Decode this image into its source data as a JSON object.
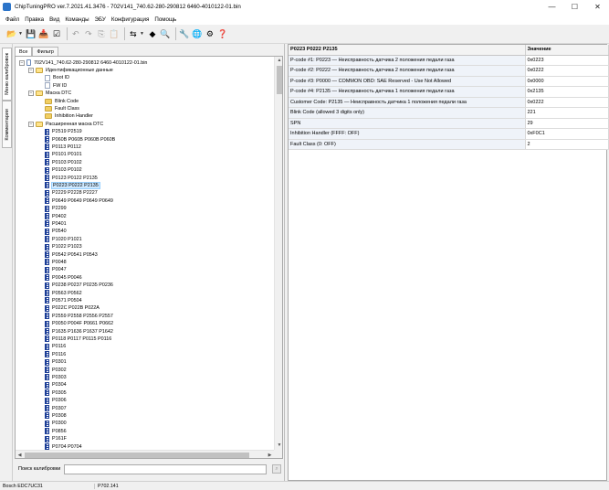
{
  "window": {
    "title": "ChipTuningPRO ver.7.2021.41.3476 - 702V141_740.62-280-290812 6460-4010122-01.bin",
    "controls": {
      "minimize": "—",
      "maximize": "☐",
      "close": "✕"
    }
  },
  "menu": [
    "Файл",
    "Правка",
    "Вид",
    "Команды",
    "ЭБУ",
    "Конфигурация",
    "Помощь"
  ],
  "toolbar": [
    {
      "name": "open-icon",
      "glyph": "📂",
      "dim": false,
      "dropdown": true
    },
    {
      "name": "save-icon",
      "glyph": "💾",
      "dim": false,
      "dropdown": false
    },
    {
      "name": "save-as-icon",
      "glyph": "📥",
      "dim": false,
      "dropdown": false
    },
    {
      "name": "checksum-icon",
      "glyph": "☑",
      "dim": false,
      "dropdown": false
    },
    {
      "name": "undo-icon",
      "glyph": "↶",
      "dim": true,
      "dropdown": false
    },
    {
      "name": "redo-icon",
      "glyph": "↷",
      "dim": true,
      "dropdown": false
    },
    {
      "name": "copy-icon",
      "glyph": "⎘",
      "dim": true,
      "dropdown": false
    },
    {
      "name": "paste-icon",
      "glyph": "📋",
      "dim": true,
      "dropdown": false
    },
    {
      "name": "compare-icon",
      "glyph": "⇆",
      "dim": false,
      "dropdown": true
    },
    {
      "name": "navigate-icon",
      "glyph": "◆",
      "dim": false,
      "dropdown": false
    },
    {
      "name": "search-icon",
      "glyph": "🔍",
      "dim": false,
      "dropdown": false
    },
    {
      "name": "tools-icon",
      "glyph": "🔧",
      "dim": false,
      "dropdown": false
    },
    {
      "name": "web-update-icon",
      "glyph": "🌐",
      "dim": false,
      "dropdown": false
    },
    {
      "name": "settings-icon",
      "glyph": "⚙",
      "dim": false,
      "dropdown": false
    },
    {
      "name": "help-icon",
      "glyph": "❓",
      "dim": false,
      "dropdown": false
    }
  ],
  "sidebar_tabs": [
    "Меню калибровок",
    "Комментарии"
  ],
  "left_tabs": [
    "Все",
    "Фильтр"
  ],
  "tree": [
    {
      "level": 0,
      "icon": "file",
      "toggle": "−",
      "label": "702V141_740.62-280-290812 6460-4010122-01.bin"
    },
    {
      "level": 1,
      "icon": "folder-open",
      "toggle": "−",
      "label": "Идентификационные данные"
    },
    {
      "level": 2,
      "icon": "page",
      "toggle": "",
      "label": "Boot ID"
    },
    {
      "level": 2,
      "icon": "page",
      "toggle": "",
      "label": "FW ID"
    },
    {
      "level": 1,
      "icon": "folder-open",
      "toggle": "−",
      "label": "Маска DTC"
    },
    {
      "level": 2,
      "icon": "folder",
      "toggle": "",
      "label": "Blink Code"
    },
    {
      "level": 2,
      "icon": "folder",
      "toggle": "",
      "label": "Fault Class"
    },
    {
      "level": 2,
      "icon": "folder",
      "toggle": "",
      "label": "Inhibition Handler"
    },
    {
      "level": 1,
      "icon": "folder-open",
      "toggle": "−",
      "label": "Расширенная маска DTC"
    },
    {
      "level": 2,
      "icon": "dtc",
      "toggle": "",
      "label": "P2519 P2519"
    },
    {
      "level": 2,
      "icon": "dtc",
      "toggle": "",
      "label": "P060B P060B P060B P060B"
    },
    {
      "level": 2,
      "icon": "dtc",
      "toggle": "",
      "label": "P0113 P0112"
    },
    {
      "level": 2,
      "icon": "dtc",
      "toggle": "",
      "label": "P0101 P0101"
    },
    {
      "level": 2,
      "icon": "dtc",
      "toggle": "",
      "label": "P0103 P0102"
    },
    {
      "level": 2,
      "icon": "dtc",
      "toggle": "",
      "label": "P0103 P0102"
    },
    {
      "level": 2,
      "icon": "dtc",
      "toggle": "",
      "label": "P0123 P0122 P2135"
    },
    {
      "level": 2,
      "icon": "dtc",
      "toggle": "",
      "label": "P0223 P0222 P2135",
      "selected": true
    },
    {
      "level": 2,
      "icon": "dtc",
      "toggle": "",
      "label": "P2229 P2228 P2227"
    },
    {
      "level": 2,
      "icon": "dtc",
      "toggle": "",
      "label": "P0649 P0649 P0649 P0649"
    },
    {
      "level": 2,
      "icon": "dtc",
      "toggle": "",
      "label": "P2299"
    },
    {
      "level": 2,
      "icon": "dtc",
      "toggle": "",
      "label": "P0402"
    },
    {
      "level": 2,
      "icon": "dtc",
      "toggle": "",
      "label": "P0401"
    },
    {
      "level": 2,
      "icon": "dtc",
      "toggle": "",
      "label": "P0540"
    },
    {
      "level": 2,
      "icon": "dtc",
      "toggle": "",
      "label": "P1020 P1021"
    },
    {
      "level": 2,
      "icon": "dtc",
      "toggle": "",
      "label": "P1022 P1023"
    },
    {
      "level": 2,
      "icon": "dtc",
      "toggle": "",
      "label": "P0542 P0541 P0543"
    },
    {
      "level": 2,
      "icon": "dtc",
      "toggle": "",
      "label": "P0048"
    },
    {
      "level": 2,
      "icon": "dtc",
      "toggle": "",
      "label": "P0047"
    },
    {
      "level": 2,
      "icon": "dtc",
      "toggle": "",
      "label": "P0045 P0046"
    },
    {
      "level": 2,
      "icon": "dtc",
      "toggle": "",
      "label": "P0238 P0237 P0235 P0236"
    },
    {
      "level": 2,
      "icon": "dtc",
      "toggle": "",
      "label": "P0563 P0562"
    },
    {
      "level": 2,
      "icon": "dtc",
      "toggle": "",
      "label": "P0571 P0504"
    },
    {
      "level": 2,
      "icon": "dtc",
      "toggle": "",
      "label": "P022C P022B P022A"
    },
    {
      "level": 2,
      "icon": "dtc",
      "toggle": "",
      "label": "P2559 P2558 P2556 P2557"
    },
    {
      "level": 2,
      "icon": "dtc",
      "toggle": "",
      "label": "P0050 P004F P0661 P0662"
    },
    {
      "level": 2,
      "icon": "dtc",
      "toggle": "",
      "label": "P1635 P1636 P1637 P1642"
    },
    {
      "level": 2,
      "icon": "dtc",
      "toggle": "",
      "label": "P0118 P0117 P0115 P0116"
    },
    {
      "level": 2,
      "icon": "dtc",
      "toggle": "",
      "label": "P0116"
    },
    {
      "level": 2,
      "icon": "dtc",
      "toggle": "",
      "label": "P0116"
    },
    {
      "level": 2,
      "icon": "dtc",
      "toggle": "",
      "label": "P0301"
    },
    {
      "level": 2,
      "icon": "dtc",
      "toggle": "",
      "label": "P0302"
    },
    {
      "level": 2,
      "icon": "dtc",
      "toggle": "",
      "label": "P0303"
    },
    {
      "level": 2,
      "icon": "dtc",
      "toggle": "",
      "label": "P0304"
    },
    {
      "level": 2,
      "icon": "dtc",
      "toggle": "",
      "label": "P0305"
    },
    {
      "level": 2,
      "icon": "dtc",
      "toggle": "",
      "label": "P0306"
    },
    {
      "level": 2,
      "icon": "dtc",
      "toggle": "",
      "label": "P0307"
    },
    {
      "level": 2,
      "icon": "dtc",
      "toggle": "",
      "label": "P0308"
    },
    {
      "level": 2,
      "icon": "dtc",
      "toggle": "",
      "label": "P0300"
    },
    {
      "level": 2,
      "icon": "dtc",
      "toggle": "",
      "label": "P0856"
    },
    {
      "level": 2,
      "icon": "dtc",
      "toggle": "",
      "label": "P161F"
    },
    {
      "level": 2,
      "icon": "dtc",
      "toggle": "",
      "label": "P0704 P0704"
    }
  ],
  "search": {
    "label": "Поиск калибровки",
    "value": "",
    "button": "⌕"
  },
  "table": {
    "headers": [
      "P0223 P0222 P2135",
      "Значение"
    ],
    "rows": [
      {
        "param": "P-code #1: P0223 — Неисправность датчика 2 положения педали газа",
        "value": "0x0223"
      },
      {
        "param": "P-code #2: P0222 — Неисправность датчика 2 положения педали газа",
        "value": "0x0222"
      },
      {
        "param": "P-code #3: P0000 — COMMON OBD: SAE Reserved - Use Not Allowed",
        "value": "0x0000"
      },
      {
        "param": "P-code #4: P2135 — Неисправность датчика 1 положения педали газа",
        "value": "0x2135"
      },
      {
        "param": "Customer Code: P2135 — Неисправность датчика 1 положения педали газа",
        "value": "0x0222"
      },
      {
        "param": "Blink Code (allowed 3 digits only)",
        "value": "221"
      },
      {
        "param": "SPN",
        "value": "29"
      },
      {
        "param": "Inhibition Handler (FFFF: OFF)",
        "value": "0xF0C1"
      },
      {
        "param": "Fault Class (0: OFF)",
        "value": "2"
      }
    ]
  },
  "status": {
    "ecu": "Bosch EDC7UC31",
    "pos": "P702.141"
  },
  "colors": {
    "accent": "#2b74c9",
    "selection": "#cde8ff",
    "param_cell": "#eff3f9"
  }
}
